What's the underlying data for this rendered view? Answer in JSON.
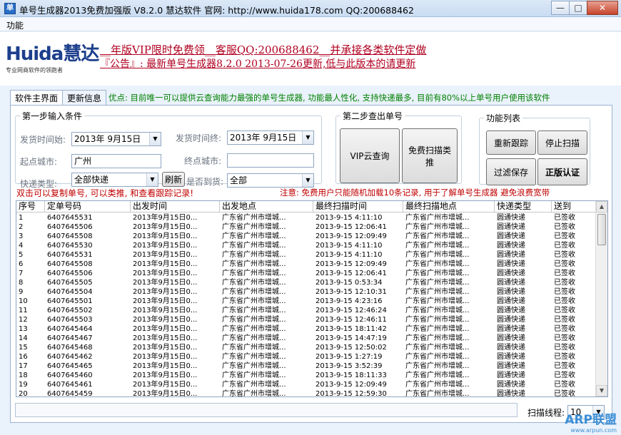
{
  "window": {
    "title": "单号生成器2013免费加强版 V8.2.0  慧达软件 官网: http://www.huida178.com   QQ:200688462",
    "icon": "app-icon",
    "minimize": "—",
    "maximize": "□",
    "close": "✕"
  },
  "menu": {
    "function": "功能"
  },
  "banner": {
    "logo": "Huida",
    "logo_cn": "慧达",
    "logo_sub": "专业网商软件的领跑者",
    "line1": "__年版VIP限时免费领__客服QQ:200688462__并承接各类软件定做",
    "line2": "『公告』: 最新单号生成器8.2.0 2013-07-26更新,低与此版本的请更新"
  },
  "tabs": [
    "软件主界面",
    "更新信息"
  ],
  "tab_info": "优点: 目前唯一可以提供云查询能力最强的单号生成器, 功能最人性化, 支持快递最多, 目前有80%以上单号用户使用该软件",
  "step1": {
    "legend": "第一步输入条件",
    "ship_start_label": "发货时间始:",
    "ship_start_value": "2013年  9月15日",
    "ship_end_label": "发货时间终:",
    "ship_end_value": "2013年  9月15日",
    "origin_label": "起点城市:",
    "origin_value": "广州",
    "dest_label": "终点城市:",
    "dest_value": "",
    "courier_label": "快递类型:",
    "courier_value": "全部快递",
    "refresh": "刷新",
    "delivered_label": "是否到货:",
    "delivered_value": "全部"
  },
  "step2": {
    "legend": "第二步查出单号",
    "vip_query": "VIP云查询",
    "free_scan": "免费扫描类推"
  },
  "functions": {
    "legend": "功能列表",
    "retrack": "重新跟踪",
    "stop_scan": "停止扫描",
    "filter_save": "过滤保存",
    "genuine": "正版认证"
  },
  "note_left": "双击可以复制单号, 可以类推, 和查看跟踪记录!",
  "note_right": "注意: 免费用户只能随机加载10条记录, 用于了解单号生成器 避免浪费宽带",
  "table": {
    "columns": [
      "序号",
      "定单号码",
      "出发时间",
      "出发地点",
      "最终扫描时间",
      "最终扫描地点",
      "快递类型",
      "送到"
    ],
    "rows": [
      [
        "1",
        "6407645531",
        "2013年9月15日0...",
        "广东省广州市增城...",
        "2013-9-15  4:11:10",
        "广东省广州市增城...",
        "圆通快递",
        "已签收"
      ],
      [
        "2",
        "6407645506",
        "2013年9月15日0...",
        "广东省广州市增城...",
        "2013-9-15 12:06:41",
        "广东省广州市增城...",
        "圆通快递",
        "已签收"
      ],
      [
        "3",
        "6407645508",
        "2013年9月15日0...",
        "广东省广州市增城...",
        "2013-9-15 12:09:49",
        "广东省广州市增城...",
        "圆通快递",
        "已签收"
      ],
      [
        "4",
        "6407645530",
        "2013年9月15日0...",
        "广东省广州市增城...",
        "2013-9-15  4:11:10",
        "广东省广州市增城...",
        "圆通快递",
        "已签收"
      ],
      [
        "5",
        "6407645531",
        "2013年9月15日0...",
        "广东省广州市增城...",
        "2013-9-15  4:11:10",
        "广东省广州市增城...",
        "圆通快递",
        "已签收"
      ],
      [
        "6",
        "6407645508",
        "2013年9月15日0...",
        "广东省广州市增城...",
        "2013-9-15 12:09:49",
        "广东省广州市增城...",
        "圆通快递",
        "已签收"
      ],
      [
        "7",
        "6407645506",
        "2013年9月15日0...",
        "广东省广州市增城...",
        "2013-9-15 12:06:41",
        "广东省广州市增城...",
        "圆通快递",
        "已签收"
      ],
      [
        "8",
        "6407645505",
        "2013年9月15日0...",
        "广东省广州市增城...",
        "2013-9-15  0:53:34",
        "广东省广州市增城...",
        "圆通快递",
        "已签收"
      ],
      [
        "9",
        "6407645504",
        "2013年9月15日0...",
        "广东省广州市增城...",
        "2013-9-15 12:10:31",
        "广东省广州市增城...",
        "圆通快递",
        "已签收"
      ],
      [
        "10",
        "6407645501",
        "2013年9月15日0...",
        "广东省广州市增城...",
        "2013-9-15  4:23:16",
        "广东省广州市增城...",
        "圆通快递",
        "已签收"
      ],
      [
        "11",
        "6407645502",
        "2013年9月15日0...",
        "广东省广州市增城...",
        "2013-9-15 12:46:24",
        "广东省广州市增城...",
        "圆通快递",
        "已签收"
      ],
      [
        "12",
        "6407645503",
        "2013年9月15日0...",
        "广东省广州市增城...",
        "2013-9-15 12:46:11",
        "广东省广州市增城...",
        "圆通快递",
        "已签收"
      ],
      [
        "13",
        "6407645464",
        "2013年9月15日0...",
        "广东省广州市增城...",
        "2013-9-15 18:11:42",
        "广东省广州市增城...",
        "圆通快递",
        "已签收"
      ],
      [
        "14",
        "6407645467",
        "2013年9月15日0...",
        "广东省广州市增城...",
        "2013-9-15 14:47:19",
        "广东省广州市增城...",
        "圆通快递",
        "已签收"
      ],
      [
        "15",
        "6407645468",
        "2013年9月15日0...",
        "广东省广州市增城...",
        "2013-9-15 12:50:02",
        "广东省广州市增城...",
        "圆通快递",
        "已签收"
      ],
      [
        "16",
        "6407645462",
        "2013年9月15日0...",
        "广东省广州市增城...",
        "2013-9-15  1:27:19",
        "广东省广州市增城...",
        "圆通快递",
        "已签收"
      ],
      [
        "17",
        "6407645465",
        "2013年9月15日0...",
        "广东省广州市增城...",
        "2013-9-15  3:52:39",
        "广东省广州市增城...",
        "圆通快递",
        "已签收"
      ],
      [
        "18",
        "6407645460",
        "2013年9月15日0...",
        "广东省广州市增城...",
        "2013-9-15 18:11:33",
        "广东省广州市增城...",
        "圆通快递",
        "已签收"
      ],
      [
        "19",
        "6407645461",
        "2013年9月15日0...",
        "广东省广州市增城...",
        "2013-9-15 12:09:49",
        "广东省广州市增城...",
        "圆通快递",
        "已签收"
      ],
      [
        "20",
        "6407645459",
        "2013年9月15日0...",
        "广东省广州市增城...",
        "2013-9-15 12:59:30",
        "广东省广州市增城...",
        "圆通快递",
        "已签收"
      ]
    ]
  },
  "footer": {
    "thread_label": "扫描线程:",
    "thread_value": "10"
  },
  "watermark": {
    "main": "ARP联盟",
    "sub": "www.arpun.com"
  }
}
